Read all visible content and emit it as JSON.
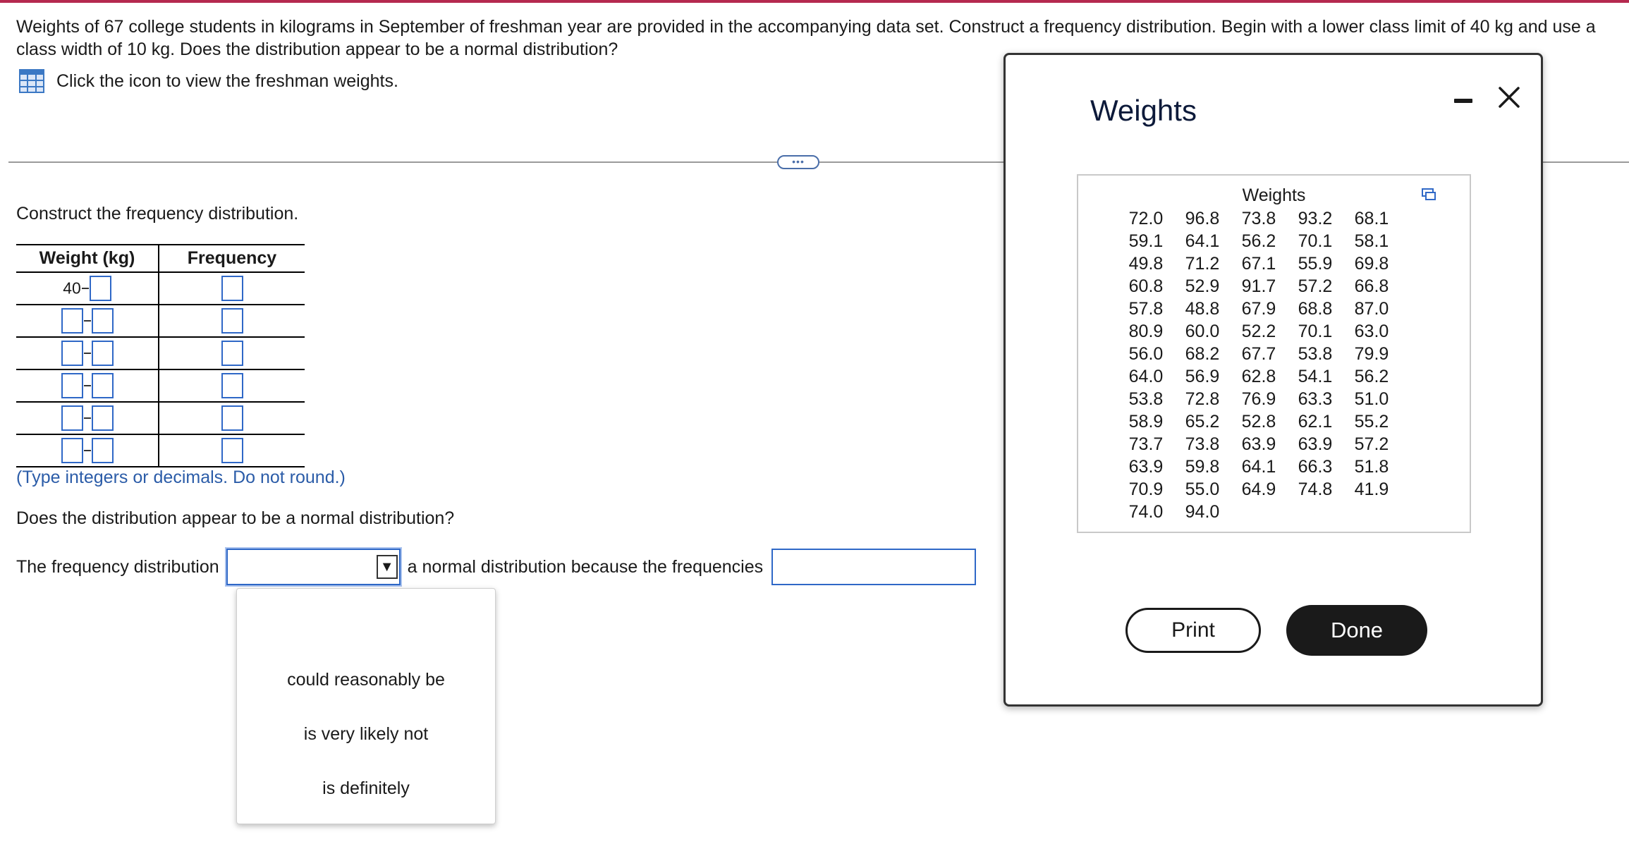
{
  "question": {
    "text": "Weights of 67 college students in kilograms in September of freshman year are provided in the accompanying data set. Construct a frequency distribution. Begin with a lower class limit of 40 kg and use a class width of 10 kg. Does the distribution appear to be a normal distribution?",
    "data_link_label": "Click the icon to view the freshman weights.",
    "data_link_icon": "table-grid-icon"
  },
  "more_button_label": "•••",
  "frequency_section": {
    "heading": "Construct the frequency distribution.",
    "table": {
      "headers": [
        "Weight (kg)",
        "Frequency"
      ],
      "first_lower_limit": "40",
      "rows": 6
    },
    "hint": "(Type integers or decimals. Do not round.)"
  },
  "normality": {
    "question": "Does the distribution appear to be a normal distribution?",
    "prefix": "The frequency distribution",
    "select_value": "",
    "middle_text": "a normal distribution because the frequencies",
    "reason_value": "",
    "options": [
      "could reasonably be",
      "is very likely not",
      "is definitely"
    ]
  },
  "dialog": {
    "title": "Weights",
    "table_heading": "Weights",
    "values": [
      "72.0",
      "96.8",
      "73.8",
      "93.2",
      "68.1",
      "59.1",
      "64.1",
      "56.2",
      "70.1",
      "58.1",
      "49.8",
      "71.2",
      "67.1",
      "55.9",
      "69.8",
      "60.8",
      "52.9",
      "91.7",
      "57.2",
      "66.8",
      "57.8",
      "48.8",
      "67.9",
      "68.8",
      "87.0",
      "80.9",
      "60.0",
      "52.2",
      "70.1",
      "63.0",
      "56.0",
      "68.2",
      "67.7",
      "53.8",
      "79.9",
      "64.0",
      "56.9",
      "62.8",
      "54.1",
      "56.2",
      "53.8",
      "72.8",
      "76.9",
      "63.3",
      "51.0",
      "58.9",
      "65.2",
      "52.8",
      "62.1",
      "55.2",
      "73.7",
      "73.8",
      "63.9",
      "63.9",
      "57.2",
      "63.9",
      "59.8",
      "64.1",
      "66.3",
      "51.8",
      "70.9",
      "55.0",
      "64.9",
      "74.8",
      "41.9",
      "74.0",
      "94.0"
    ],
    "print_label": "Print",
    "done_label": "Done"
  },
  "colors": {
    "accent_bar": "#b5294f",
    "input_border": "#2f68c7",
    "hint_text": "#2b5ca8"
  }
}
